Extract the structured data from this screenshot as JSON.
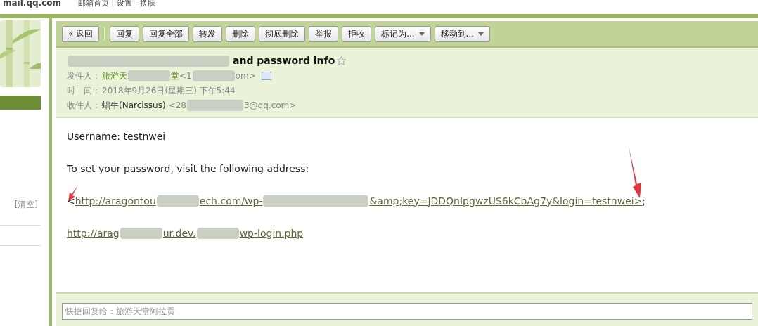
{
  "top_bar": {
    "site": "mail.qq.com",
    "links": "邮箱首页 | 设置 - 换肤"
  },
  "sidebar": {
    "clear_link": "[清空]"
  },
  "toolbar": {
    "buttons": [
      {
        "label": "« 返回",
        "kind": "plain"
      },
      {
        "kind": "separator"
      },
      {
        "label": "回复",
        "kind": "plain"
      },
      {
        "label": "回复全部",
        "kind": "plain"
      },
      {
        "label": "转发",
        "kind": "plain"
      },
      {
        "label": "删除",
        "kind": "plain"
      },
      {
        "label": "彻底删除",
        "kind": "plain"
      },
      {
        "label": "举报",
        "kind": "plain"
      },
      {
        "label": "拒收",
        "kind": "plain"
      },
      {
        "label": "标记为...",
        "kind": "dropdown"
      },
      {
        "label": "移动到...",
        "kind": "dropdown"
      }
    ]
  },
  "message": {
    "subject": "and password info",
    "starred": false,
    "fields": [
      {
        "label": "发件人：",
        "parts": [
          {
            "text": "旅游天",
            "kind": "name"
          },
          {
            "kind": "blur"
          },
          {
            "text": "堂",
            "kind": "name"
          },
          {
            "text": "<1",
            "kind": "plain"
          },
          {
            "kind": "blur"
          },
          {
            "text": "om>",
            "kind": "plain"
          },
          {
            "kind": "card"
          }
        ]
      },
      {
        "label": "时　间：",
        "parts": [
          {
            "text": "2018年9月26日(星期三) 下午5:44",
            "kind": "plain"
          }
        ]
      },
      {
        "label": "收件人：",
        "parts": [
          {
            "text": "蜗牛(Narcissus)",
            "kind": "dark"
          },
          {
            "text": "<28",
            "kind": "plain"
          },
          {
            "kind": "blur"
          },
          {
            "text": "3@qq.com>",
            "kind": "plain"
          }
        ]
      }
    ]
  },
  "body": {
    "lines": [
      {
        "kind": "text",
        "parts": [
          {
            "text": "Username: testnwei",
            "kind": "plain"
          }
        ]
      },
      {
        "kind": "text",
        "parts": [
          {
            "text": "To set your password, visit the following address:",
            "kind": "plain"
          }
        ]
      },
      {
        "kind": "text",
        "parts": [
          {
            "text": "<",
            "kind": "plain"
          },
          {
            "text": "http://aragontou",
            "kind": "link"
          },
          {
            "kind": "blur"
          },
          {
            "text": "ech.com/wp-",
            "kind": "link"
          },
          {
            "kind": "blur"
          },
          {
            "text": "&amp;key=JDDQnIpgwzUS6kCbAg7y&login=testnwei>",
            "kind": "link"
          },
          {
            "text": ";",
            "kind": "plain"
          }
        ]
      },
      {
        "kind": "text",
        "parts": [
          {
            "text": "http://arag",
            "kind": "link"
          },
          {
            "kind": "blur"
          },
          {
            "text": "ur.dev.",
            "kind": "link"
          },
          {
            "kind": "blur"
          },
          {
            "text": "wp-login.php",
            "kind": "link"
          }
        ]
      }
    ]
  },
  "quick_reply": {
    "placeholder": "快捷回复给：旅游天堂阿拉贡"
  }
}
